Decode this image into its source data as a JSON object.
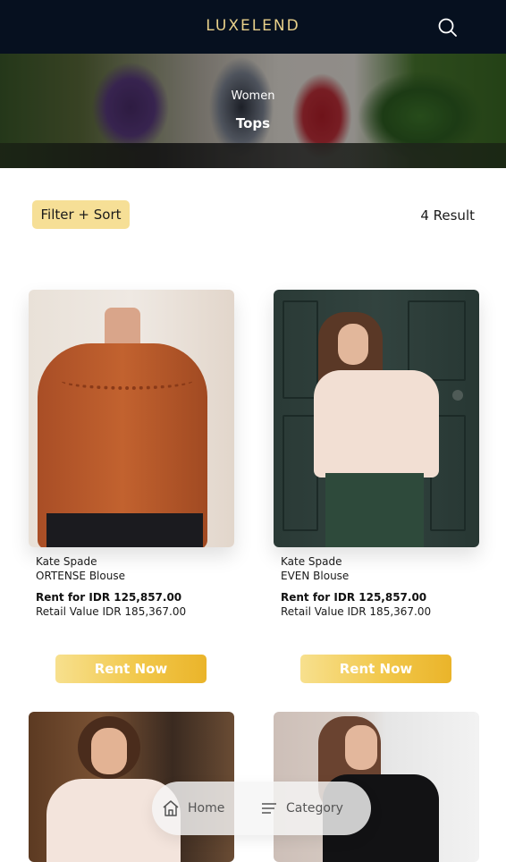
{
  "header": {
    "brand": "LUXELEND",
    "search_icon": "search-icon"
  },
  "hero": {
    "subtitle": "Women",
    "title": "Tops"
  },
  "toolbar": {
    "filter_label": "Filter + Sort",
    "result_count": "4 Result"
  },
  "products": [
    {
      "brand": "Kate Spade",
      "name": "ORTENSE Blouse",
      "rent_price": "Rent for IDR 125,857.00",
      "retail_value": "Retail Value IDR 185,367.00",
      "cta": "Rent Now"
    },
    {
      "brand": "Kate Spade",
      "name": "EVEN Blouse",
      "rent_price": "Rent for IDR 125,857.00",
      "retail_value": "Retail Value IDR 185,367.00",
      "cta": "Rent Now"
    },
    {},
    {}
  ],
  "bottom_nav": {
    "items": [
      {
        "label": "Home",
        "icon": "home-icon"
      },
      {
        "label": "Category",
        "icon": "menu-lines-icon"
      }
    ]
  },
  "colors": {
    "header_bg": "#06101f",
    "brand_gold": "#e8d08a",
    "filter_bg": "#f6df96",
    "cta_gradient_start": "#f7e08e",
    "cta_gradient_end": "#eab42a"
  }
}
